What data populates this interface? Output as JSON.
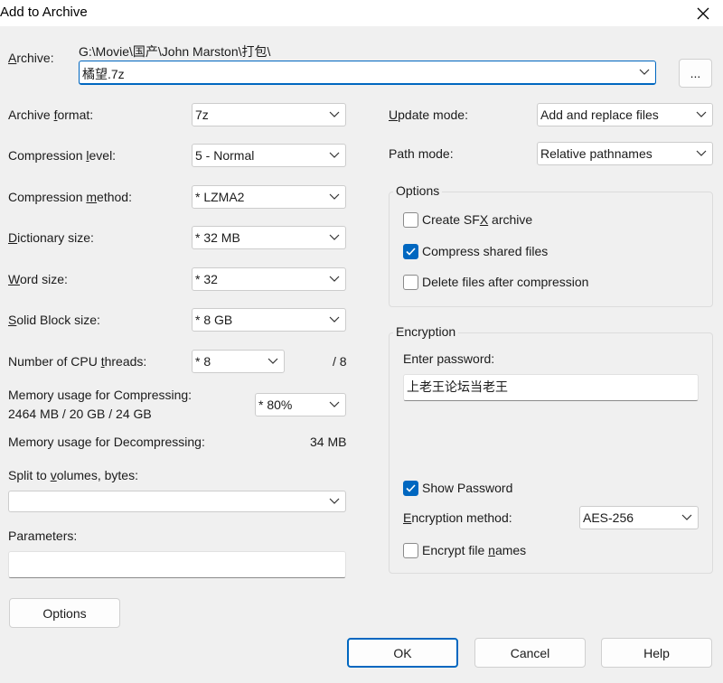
{
  "window": {
    "title": "Add to Archive",
    "close_icon": "close-icon"
  },
  "archive": {
    "label": "Archive:",
    "path": "G:\\Movie\\国产\\John Marston\\打包\\",
    "value": "橘望.7z",
    "browse_label": "..."
  },
  "left": {
    "format": {
      "label": "Archive format:",
      "value": "7z"
    },
    "level": {
      "label": "Compression level:",
      "value": "5 - Normal"
    },
    "method": {
      "label": "Compression method:",
      "value": "*  LZMA2"
    },
    "dictionary": {
      "label": "Dictionary size:",
      "value": "*  32 MB"
    },
    "word": {
      "label": "Word size:",
      "value": "*  32"
    },
    "solid": {
      "label": "Solid Block size:",
      "value": "*  8 GB"
    },
    "threads": {
      "label": "Number of CPU threads:",
      "value": "*  8",
      "max": "/ 8"
    },
    "mem_compress": {
      "label": "Memory usage for Compressing:",
      "detail": "2464 MB / 20 GB / 24 GB",
      "value": "*  80%"
    },
    "mem_decompress": {
      "label": "Memory usage for Decompressing:",
      "value": "34 MB"
    },
    "split": {
      "label": "Split to volumes, bytes:",
      "value": ""
    },
    "params": {
      "label": "Parameters:",
      "value": ""
    },
    "options_button": "Options"
  },
  "right": {
    "update": {
      "label": "Update mode:",
      "value": "Add and replace files"
    },
    "path": {
      "label": "Path mode:",
      "value": "Relative pathnames"
    },
    "options": {
      "title": "Options",
      "sfx": {
        "label": "Create SFX archive",
        "checked": false
      },
      "shared": {
        "label": "Compress shared files",
        "checked": true
      },
      "delete": {
        "label": "Delete files after compression",
        "checked": false
      }
    },
    "encryption": {
      "title": "Encryption",
      "password_label": "Enter password:",
      "password_value": "上老王论坛当老王",
      "show_password": {
        "label": "Show Password",
        "checked": true
      },
      "method_label": "Encryption method:",
      "method_value": "AES-256",
      "encrypt_names": {
        "label": "Encrypt file names",
        "checked": false
      }
    }
  },
  "buttons": {
    "ok": "OK",
    "cancel": "Cancel",
    "help": "Help"
  },
  "colors": {
    "accent": "#0067c0",
    "background": "#f0f0f0"
  }
}
